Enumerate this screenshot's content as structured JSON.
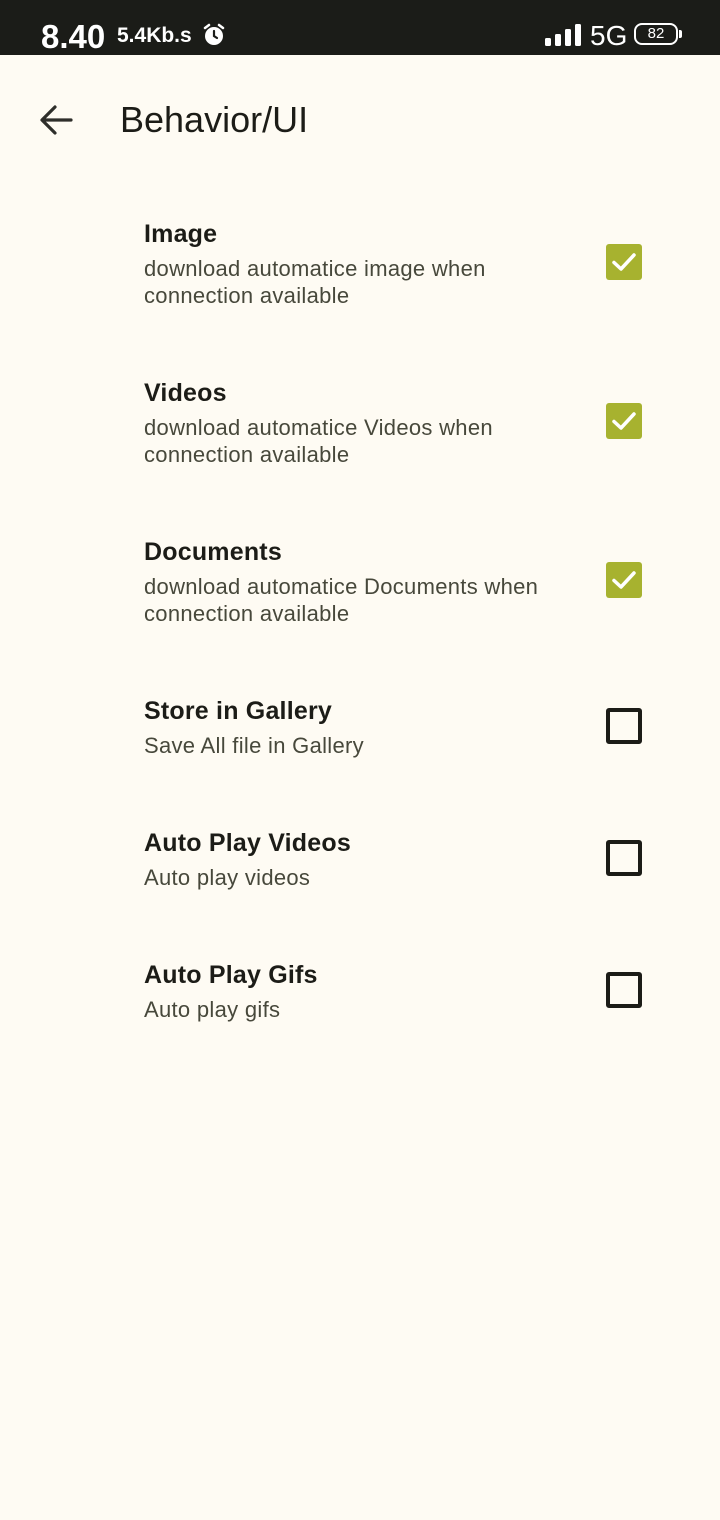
{
  "status_bar": {
    "time": "8.40",
    "net_speed": "5.4Kb.s",
    "network": "5G",
    "battery": "82"
  },
  "app_bar": {
    "title": "Behavior/UI"
  },
  "settings": [
    {
      "title": "Image",
      "summary": "download automatice image when connection available",
      "checked": true
    },
    {
      "title": "Videos",
      "summary": "download automatice Videos when connection available",
      "checked": true
    },
    {
      "title": "Documents",
      "summary": "download automatice Documents when connection available",
      "checked": true
    },
    {
      "title": "Store in Gallery",
      "summary": "Save All file in Gallery",
      "checked": false
    },
    {
      "title": "Auto Play Videos",
      "summary": "Auto play videos",
      "checked": false
    },
    {
      "title": "Auto Play Gifs",
      "summary": "Auto play gifs",
      "checked": false
    }
  ],
  "colors": {
    "background": "#FEFBF3",
    "status_bar": "#1B1C18",
    "checkbox_checked": "#A7B22F",
    "text_primary": "#1C1C17",
    "text_secondary": "#47483B"
  },
  "icons": {
    "back": "arrow-back-icon",
    "alarm": "alarm-icon",
    "signal": "signal-icon",
    "battery": "battery-icon",
    "check": "check-icon"
  }
}
